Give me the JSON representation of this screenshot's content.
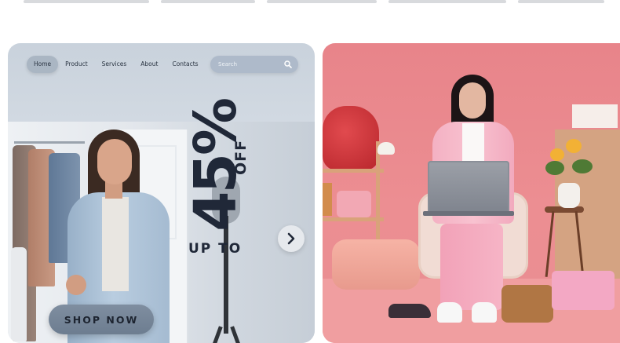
{
  "left_banner": {
    "nav": {
      "items": [
        "Home",
        "Product",
        "Services",
        "About",
        "Contacts"
      ],
      "active_index": 0
    },
    "search": {
      "placeholder": "Search",
      "icon": "search-icon"
    },
    "promo": {
      "prefix": "UP TO",
      "percent": "45%",
      "suffix": "OFF"
    },
    "next_arrow_icon": "chevron-right-icon",
    "cta_label": "SHOP NOW",
    "colors": {
      "text_dark": "#202838",
      "background": "#c9d2dc",
      "button": "#7f8ea0"
    }
  },
  "right_banner": {
    "colors": {
      "background": "#e8848a"
    }
  }
}
